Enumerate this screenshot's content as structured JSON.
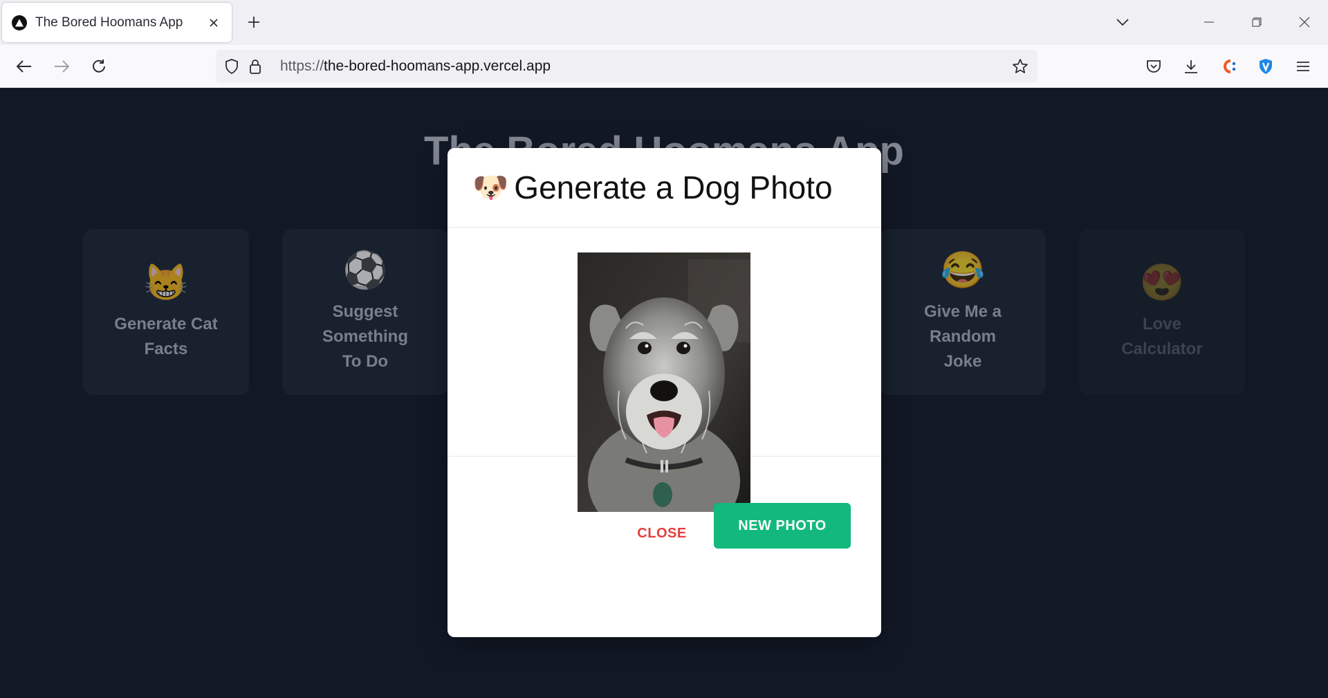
{
  "browser": {
    "tab_title": "The Bored Hoomans App",
    "url_scheme": "https://",
    "url_host": "the-bored-hoomans-app.vercel.app"
  },
  "page": {
    "title": "The Bored Hoomans App",
    "cards": [
      {
        "emoji": "😸",
        "label": "Generate Cat Facts",
        "icon": "cat-face-icon"
      },
      {
        "emoji": "⚽",
        "label": "Suggest Something To Do",
        "icon": "soccer-ball-icon"
      },
      {
        "emoji": "😂",
        "label": "Give Me a Random Joke",
        "icon": "laughing-face-icon"
      },
      {
        "emoji": "😍",
        "label": "Love Calculator",
        "icon": "heart-eyes-icon"
      }
    ]
  },
  "modal": {
    "emoji": "🐶",
    "title": "Generate a Dog Photo",
    "close_label": "CLOSE",
    "new_photo_label": "NEW PHOTO",
    "image_subject": "schnauzer dog photo"
  },
  "colors": {
    "page_bg": "#171f2e",
    "card_bg": "#222c3d",
    "close_text": "#e53e3e",
    "primary_button": "#13b97c"
  }
}
